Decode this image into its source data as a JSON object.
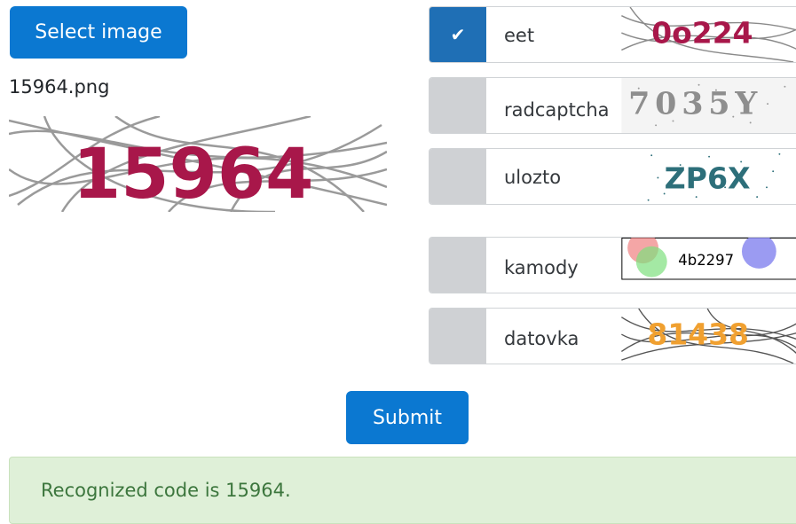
{
  "select_button": "Select image",
  "filename": "15964.png",
  "preview_code": "15964",
  "options": [
    {
      "label": "eet",
      "checked": true,
      "sample": "0o224"
    },
    {
      "label": "radcaptcha",
      "checked": false,
      "sample": "7035Y"
    },
    {
      "label": "ulozto",
      "checked": false,
      "sample": "ZP6X"
    },
    {
      "label": "kamody",
      "checked": false,
      "sample": "4b2297"
    },
    {
      "label": "datovka",
      "checked": false,
      "sample": "81438"
    }
  ],
  "check_mark": "✔",
  "submit_button": "Submit",
  "result_text": "Recognized code is 15964.",
  "colors": {
    "primary": "#0b78d1",
    "checked": "#1f6fb5",
    "unchecked": "#cfd1d4",
    "alert_bg": "#dff0d8",
    "alert_text": "#3c763d",
    "captcha_red": "#a8174a"
  }
}
